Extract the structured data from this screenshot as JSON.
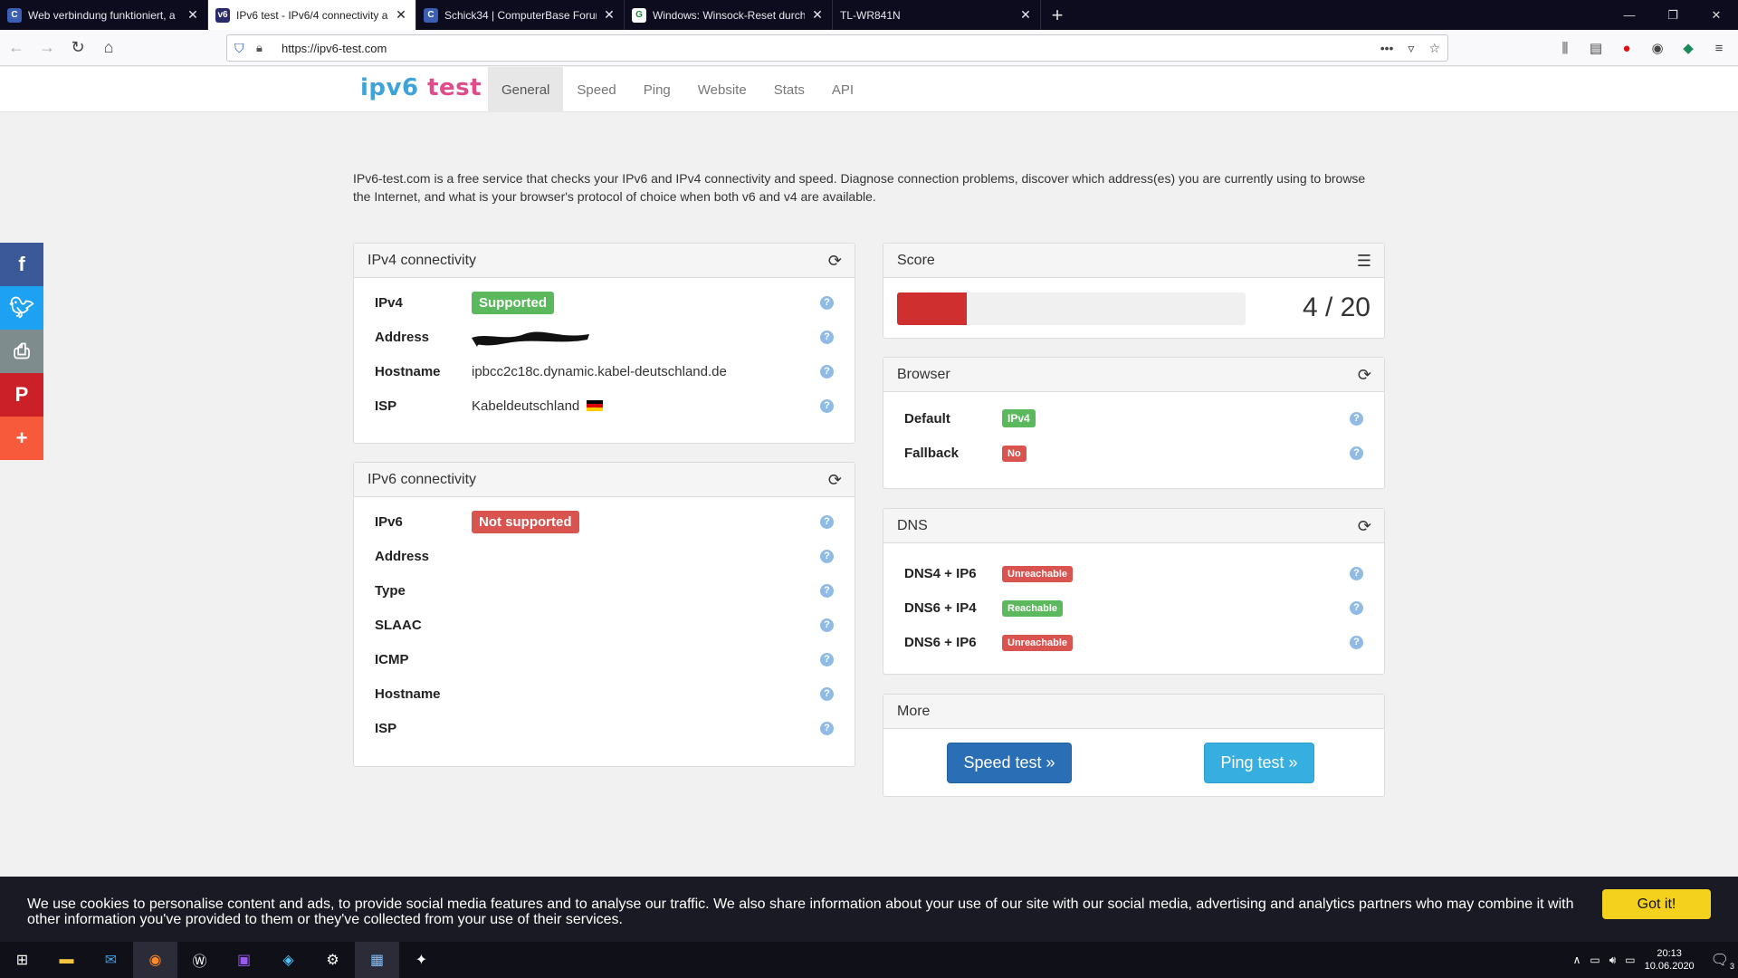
{
  "browser": {
    "tabs": [
      {
        "title": "Web verbindung funktioniert, a",
        "active": false,
        "icon": "cb-icon"
      },
      {
        "title": "IPv6 test - IPv6/4 connectivity a",
        "active": true,
        "icon": "v6-icon"
      },
      {
        "title": "Schick34 | ComputerBase Forur",
        "active": false,
        "icon": "cb-icon"
      },
      {
        "title": "Windows: Winsock-Reset durch",
        "active": false,
        "icon": "g-icon"
      },
      {
        "title": "TL-WR841N",
        "active": false,
        "icon": ""
      }
    ],
    "url": "https://ipv6-test.com"
  },
  "site": {
    "logo_a": "ipv6",
    "logo_b": " test",
    "menu": [
      "General",
      "Speed",
      "Ping",
      "Website",
      "Stats",
      "API"
    ],
    "active_menu": "General",
    "intro": "IPv6-test.com is a free service that checks your IPv6 and IPv4 connectivity and speed. Diagnose connection problems, discover which address(es) you are currently using to browse the Internet, and what is your browser's protocol of choice when both v6 and v4 are available."
  },
  "ipv4": {
    "title": "IPv4 connectivity",
    "rows": [
      {
        "key": "IPv4",
        "value": "Supported",
        "badge": "ok"
      },
      {
        "key": "Address",
        "value": ""
      },
      {
        "key": "Hostname",
        "value": "ipbcc2c18c.dynamic.kabel-deutschland.de"
      },
      {
        "key": "ISP",
        "value": "Kabeldeutschland"
      }
    ]
  },
  "ipv6": {
    "title": "IPv6 connectivity",
    "rows": [
      {
        "key": "IPv6",
        "value": "Not supported",
        "badge": "bad"
      },
      {
        "key": "Address",
        "value": ""
      },
      {
        "key": "Type",
        "value": ""
      },
      {
        "key": "SLAAC",
        "value": ""
      },
      {
        "key": "ICMP",
        "value": ""
      },
      {
        "key": "Hostname",
        "value": ""
      },
      {
        "key": "ISP",
        "value": ""
      }
    ]
  },
  "score": {
    "title": "Score",
    "value": 4,
    "max": 20,
    "text": "4 / 20"
  },
  "browser_panel": {
    "title": "Browser",
    "rows": [
      {
        "key": "Default",
        "value": "IPv4",
        "badge": "ok"
      },
      {
        "key": "Fallback",
        "value": "No",
        "badge": "bad"
      }
    ]
  },
  "dns": {
    "title": "DNS",
    "rows": [
      {
        "key": "DNS4 + IP6",
        "value": "Unreachable",
        "badge": "bad"
      },
      {
        "key": "DNS6 + IP4",
        "value": "Reachable",
        "badge": "ok"
      },
      {
        "key": "DNS6 + IP6",
        "value": "Unreachable",
        "badge": "bad"
      }
    ]
  },
  "more": {
    "title": "More",
    "speed_btn": "Speed test »",
    "ping_btn": "Ping test »"
  },
  "cookie": {
    "text": "We use cookies to personalise content and ads, to provide social media features and to analyse our traffic. We also share information about your use of our site with our social media, advertising and analytics partners who may combine it with other information you've provided to them or they've collected from your use of their services.",
    "button": "Got it!"
  },
  "taskbar": {
    "time": "20:13",
    "date": "10.06.2020",
    "notifications": "3"
  },
  "colors": {
    "ok": "#5cb85c",
    "bad": "#d9534f",
    "score_fill": "#cf2f2f",
    "brand_blue": "#3fa3d9",
    "brand_pink": "#e04b8b"
  }
}
